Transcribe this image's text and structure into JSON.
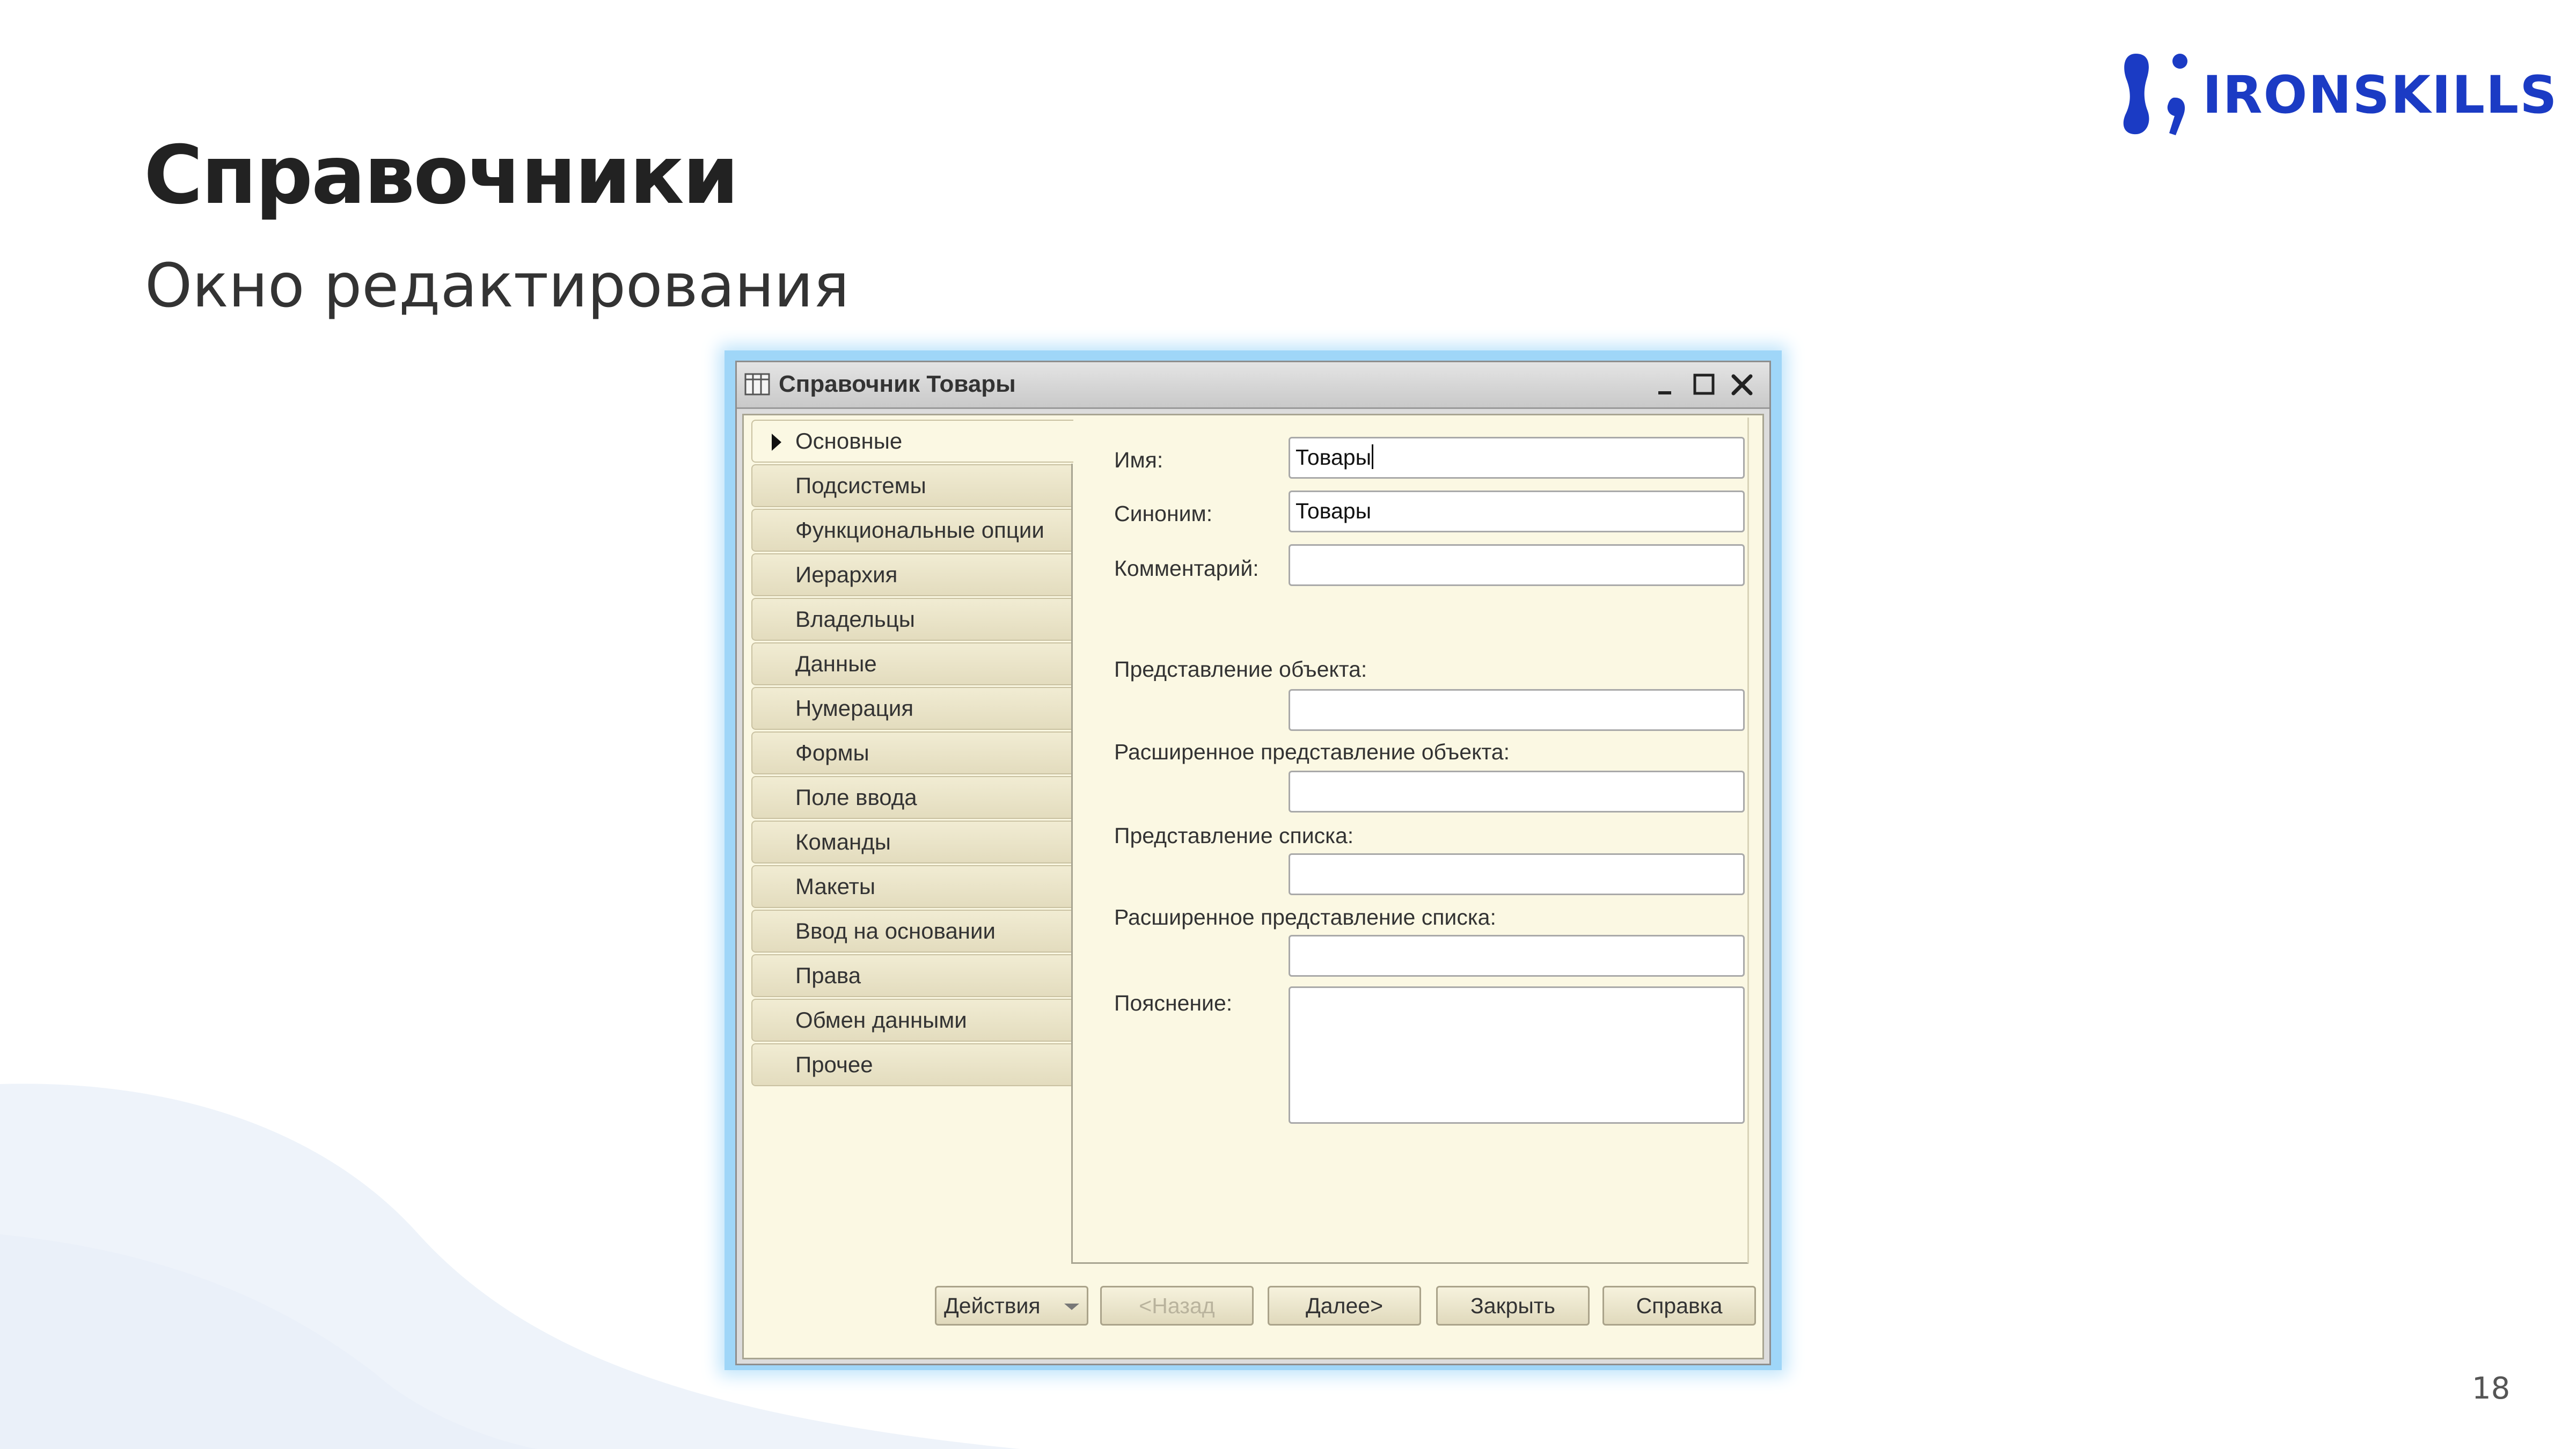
{
  "slide": {
    "title": "Справочники",
    "subtitle": "Окно редактирования",
    "page_number": "18"
  },
  "logo": {
    "text": "IRONSKILLS",
    "brand_color": "#1b3bc4",
    "icon": "ironskills-logo-icon"
  },
  "window": {
    "title": "Справочник Товары",
    "title_icon": "table-icon",
    "controls": [
      "minimize-icon",
      "maximize-icon",
      "close-icon"
    ]
  },
  "tabs": [
    "Основные",
    "Подсистемы",
    "Функциональные опции",
    "Иерархия",
    "Владельцы",
    "Данные",
    "Нумерация",
    "Формы",
    "Поле ввода",
    "Команды",
    "Макеты",
    "Ввод на основании",
    "Права",
    "Обмен данными",
    "Прочее"
  ],
  "active_tab": "Основные",
  "form": {
    "name_label": "Имя:",
    "name_value": "Товары",
    "synonym_label": "Синоним:",
    "synonym_value": "Товары",
    "comment_label": "Комментарий:",
    "comment_value": "",
    "object_presentation_label": "Представление объекта:",
    "object_presentation_value": "",
    "ext_object_presentation_label": "Расширенное представление объекта:",
    "ext_object_presentation_value": "",
    "list_presentation_label": "Представление списка:",
    "list_presentation_value": "",
    "ext_list_presentation_label": "Расширенное представление списка:",
    "ext_list_presentation_value": "",
    "explanation_label": "Пояснение:",
    "explanation_value": ""
  },
  "buttons": {
    "actions": "Действия",
    "back": "<Назад",
    "next": "Далее>",
    "close": "Закрыть",
    "help": "Справка"
  }
}
